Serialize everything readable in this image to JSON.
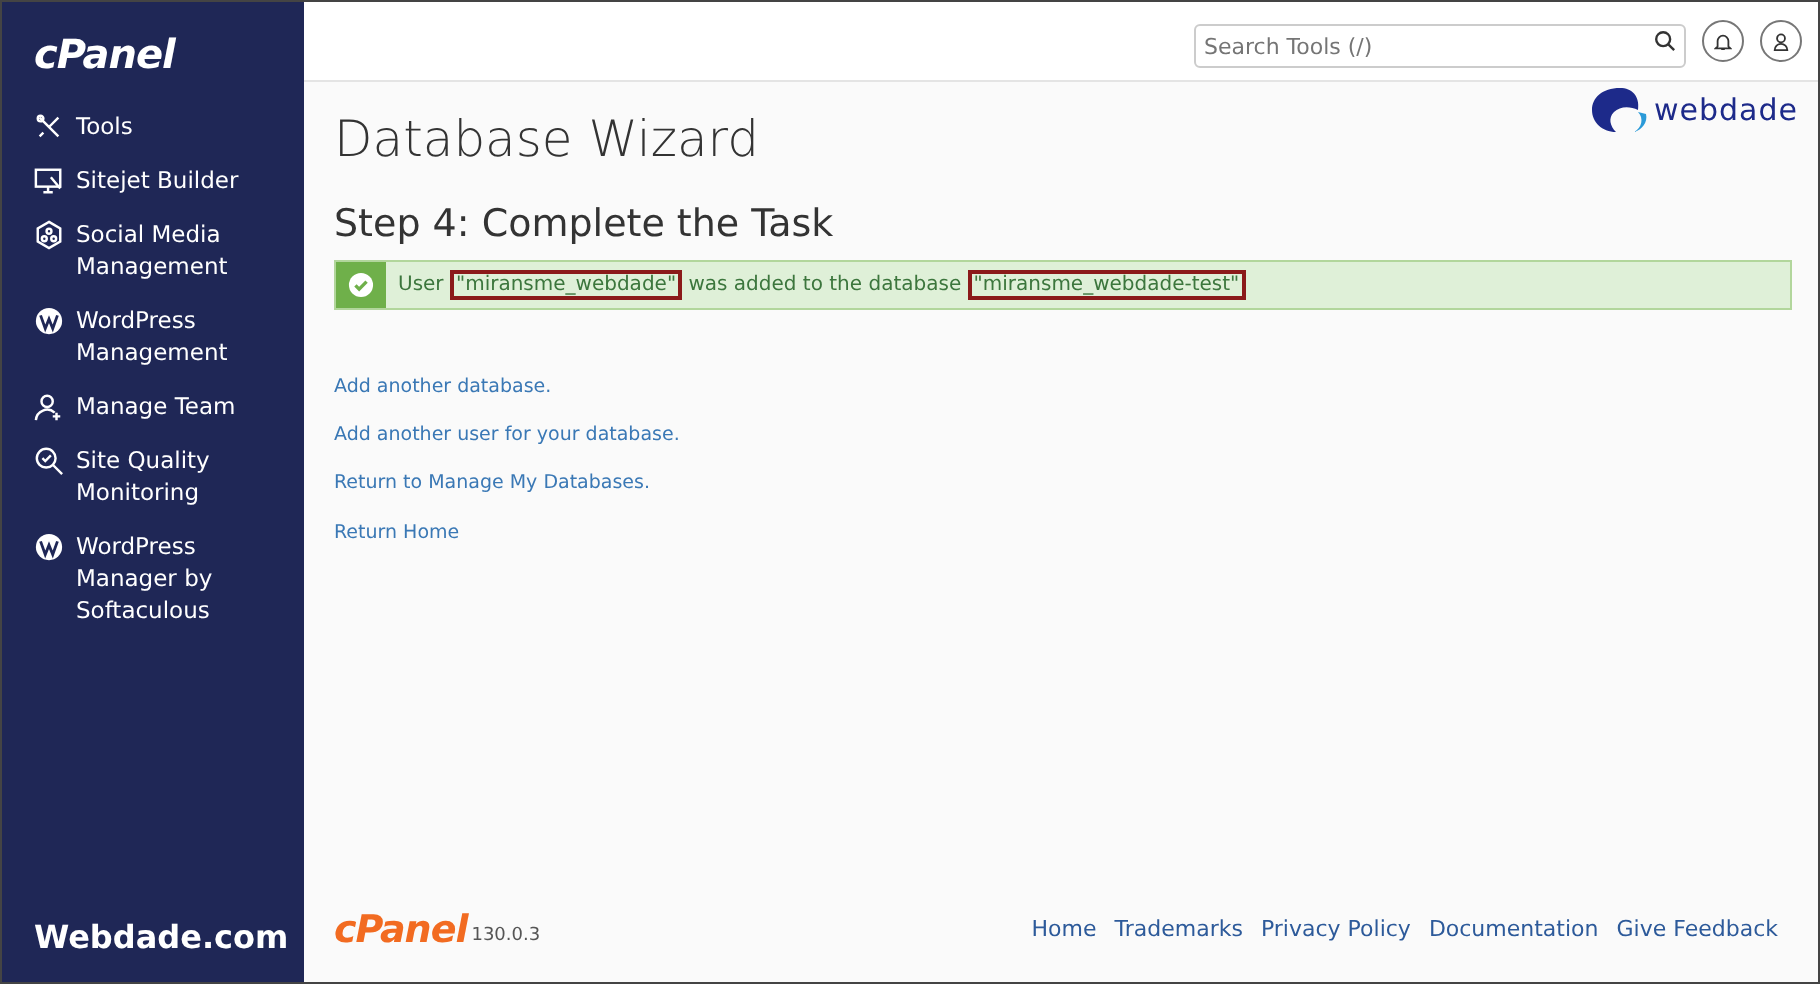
{
  "sidebar": {
    "logo": "cPanel",
    "items": [
      {
        "kind": "tools",
        "label": "Tools"
      },
      {
        "kind": "sitejet",
        "label": "Sitejet Builder"
      },
      {
        "kind": "social",
        "label": "Social Media Management"
      },
      {
        "kind": "wordpress",
        "label": "WordPress Management"
      },
      {
        "kind": "team",
        "label": "Manage Team"
      },
      {
        "kind": "quality",
        "label": "Site Quality Monitoring"
      },
      {
        "kind": "wordpress",
        "label": "WordPress Manager by Softaculous"
      }
    ],
    "footer": "Webdade.com"
  },
  "header": {
    "search": {
      "placeholder": "Search Tools (/)"
    }
  },
  "brand": "webdade",
  "title": "Database Wizard",
  "step": "Step 4: Complete the Task",
  "alert": {
    "parts": [
      {
        "text": "User ",
        "highlighted": false
      },
      {
        "text": "\"miransme_webdade\"",
        "highlighted": true
      },
      {
        "text": " was added to the database ",
        "highlighted": false
      },
      {
        "text": "\"miransme_webdade-test\"",
        "highlighted": true
      }
    ]
  },
  "links": [
    "Add another database.",
    "Add another user for your database.",
    "Return to Manage My Databases.",
    "Return Home"
  ],
  "footer": {
    "logo": "cPanel",
    "version": "130.0.3",
    "links": [
      "Home",
      "Trademarks",
      "Privacy Policy",
      "Documentation",
      "Give Feedback"
    ]
  }
}
